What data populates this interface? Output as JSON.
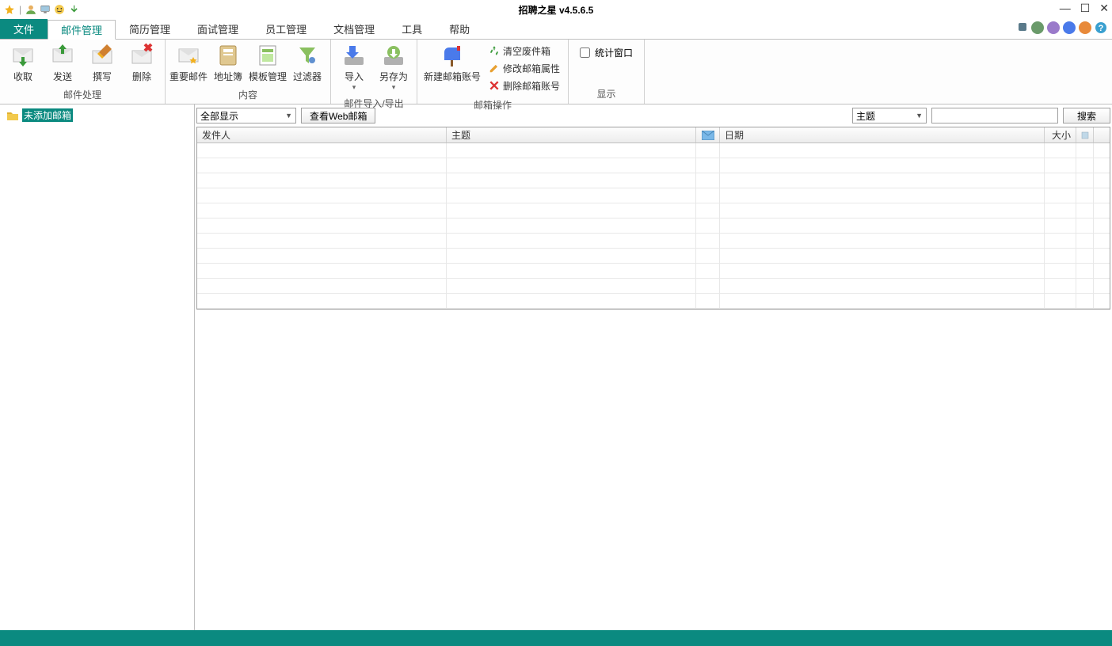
{
  "window": {
    "title": "招聘之星 v4.5.6.5"
  },
  "menu": {
    "file": "文件",
    "tabs": [
      "邮件管理",
      "简历管理",
      "面试管理",
      "员工管理",
      "文档管理",
      "工具",
      "帮助"
    ],
    "active_index": 0
  },
  "ribbon": {
    "groups": [
      {
        "label": "邮件处理",
        "items": [
          "收取",
          "发送",
          "撰写",
          "删除"
        ]
      },
      {
        "label": "内容",
        "items": [
          "重要邮件",
          "地址簿",
          "模板管理",
          "过滤器"
        ]
      },
      {
        "label": "邮件导入/导出",
        "items": [
          "导入",
          "另存为"
        ]
      },
      {
        "label": "邮箱操作",
        "items": [
          "新建邮箱账号"
        ],
        "vlist": [
          "清空废件箱",
          "修改邮箱属性",
          "删除邮箱账号"
        ]
      },
      {
        "label": "显示",
        "checkbox": "统计窗口"
      }
    ]
  },
  "sidebar": {
    "root": "未添加邮箱"
  },
  "filter": {
    "show_all": "全部显示",
    "web_mail": "查看Web邮箱",
    "search_field": "主题",
    "search_btn": "搜索"
  },
  "grid": {
    "columns": {
      "sender": "发件人",
      "subject": "主题",
      "date": "日期",
      "size": "大小"
    }
  },
  "colors": {
    "accent": "#0b8a80",
    "dots": [
      "#5a7a8a",
      "#6a9a6a",
      "#9a7aca",
      "#4a7aea",
      "#e88a3a",
      "#3aa0d0"
    ]
  }
}
